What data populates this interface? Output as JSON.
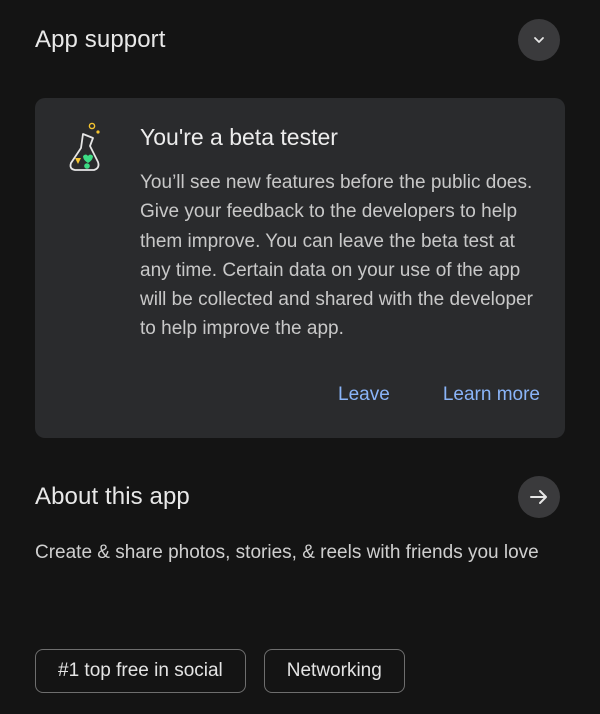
{
  "app_support": {
    "title": "App support",
    "toggle_icon": "chevron-down-icon"
  },
  "beta": {
    "icon": "flask-icon",
    "title": "You're a beta tester",
    "body": "You’ll see new features before the public does. Give your feedback to the developers to help them improve. You can leave the beta test at any time. Certain data on your use of the app will be collected and shared with the developer to help improve the app.",
    "leave_label": "Leave",
    "learn_more_label": "Learn more",
    "accent_color": "#8ab4f8"
  },
  "about": {
    "title": "About this app",
    "arrow_icon": "arrow-right-icon",
    "description": "Create & share photos, stories, & reels with friends you love"
  },
  "chips": [
    {
      "label": "#1 top free in social"
    },
    {
      "label": "Networking"
    }
  ]
}
